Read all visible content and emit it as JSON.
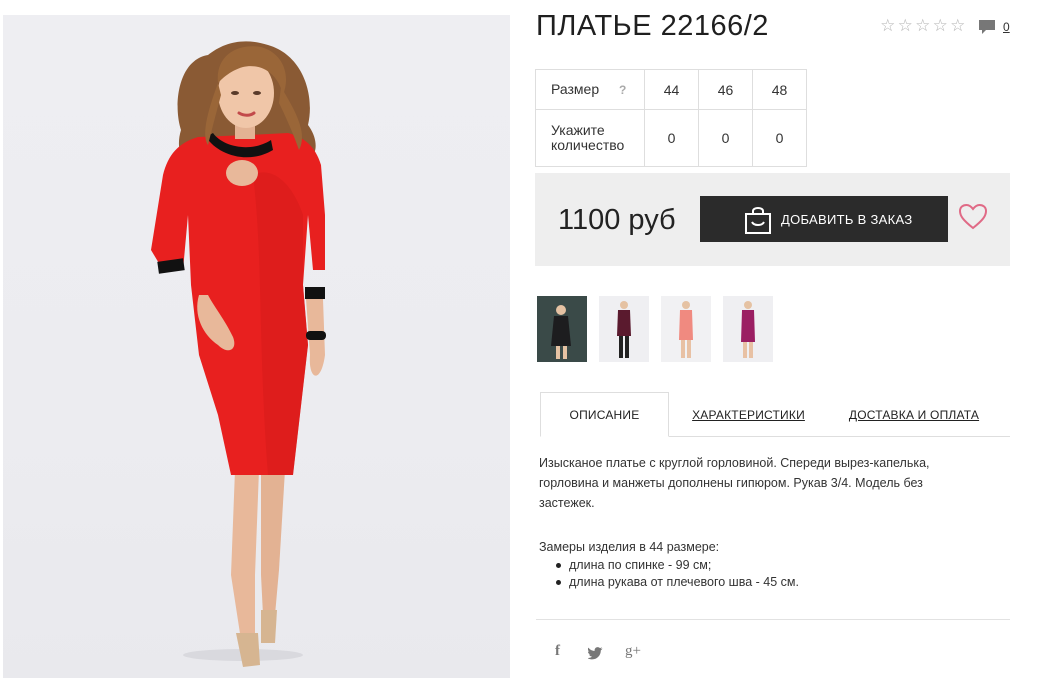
{
  "product": {
    "title": "ПЛАТЬЕ 22166/2",
    "rating_stars": [
      "☆",
      "☆",
      "☆",
      "☆",
      "☆"
    ],
    "comments_count": "0"
  },
  "sizes": {
    "size_label": "Размер",
    "help_mark": "?",
    "quantity_label_line1": "Укажите",
    "quantity_label_line2": "количество",
    "values": [
      "44",
      "46",
      "48"
    ],
    "quantities": [
      "0",
      "0",
      "0"
    ]
  },
  "order": {
    "price": "1100 руб",
    "button_label": "ДОБАВИТЬ В ЗАКАЗ"
  },
  "thumbnails": [
    {
      "name": "thumb-black-dress",
      "color": "#1d1d1f"
    },
    {
      "name": "thumb-burgundy-dress",
      "color": "#5a1a2e"
    },
    {
      "name": "thumb-coral-dress",
      "color": "#f08a80"
    },
    {
      "name": "thumb-plum-dress",
      "color": "#9b1f63"
    }
  ],
  "tabs": {
    "description": "ОПИСАНИЕ",
    "characteristics": "ХАРАКТЕРИСТИКИ",
    "delivery": "ДОСТАВКА И ОПЛАТА"
  },
  "description": {
    "text": "Изысканое платье с круглой горловиной. Спереди вырез-капелька, горловина и манжеты дополнены гипюром. Рукав 3/4. Модель без застежек.",
    "measurements_title": "Замеры изделия в 44 размере:",
    "measurements": [
      "длина по спинке - 99 см;",
      "длина рукава от плечевого шва - 45 см."
    ]
  },
  "social": {
    "facebook": "f",
    "twitter": "twitter-icon",
    "googleplus": "g+"
  },
  "colors": {
    "dress_red": "#e8201f",
    "button_dark": "#2b2b2b",
    "heart_pink": "#e06a86",
    "order_bg": "#eeeeee"
  }
}
